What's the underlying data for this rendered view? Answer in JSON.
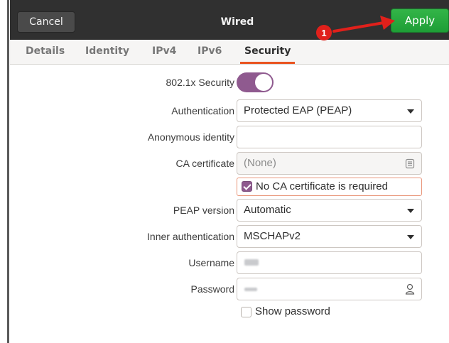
{
  "header": {
    "cancel_label": "Cancel",
    "title": "Wired",
    "apply_label": "Apply"
  },
  "annotation": {
    "step_number": "1",
    "color": "#e0201b"
  },
  "tabs": [
    {
      "label": "Details",
      "active": false
    },
    {
      "label": "Identity",
      "active": false
    },
    {
      "label": "IPv4",
      "active": false
    },
    {
      "label": "IPv6",
      "active": false
    },
    {
      "label": "Security",
      "active": true
    }
  ],
  "form": {
    "security_toggle": {
      "label": "802.1x Security",
      "enabled": true
    },
    "authentication": {
      "label": "Authentication",
      "value": "Protected EAP (PEAP)"
    },
    "anonymous_identity": {
      "label": "Anonymous identity",
      "value": ""
    },
    "ca_certificate": {
      "label": "CA certificate",
      "value": "(None)"
    },
    "no_ca_required": {
      "label": "No CA certificate is required",
      "checked": true
    },
    "peap_version": {
      "label": "PEAP version",
      "value": "Automatic"
    },
    "inner_authentication": {
      "label": "Inner authentication",
      "value": "MSCHAPv2"
    },
    "username": {
      "label": "Username"
    },
    "password": {
      "label": "Password"
    },
    "show_password": {
      "label": "Show password",
      "checked": false
    }
  },
  "colors": {
    "accent": "#8f5a8f",
    "apply_green": "#26a269",
    "tab_underline": "#e95420"
  }
}
